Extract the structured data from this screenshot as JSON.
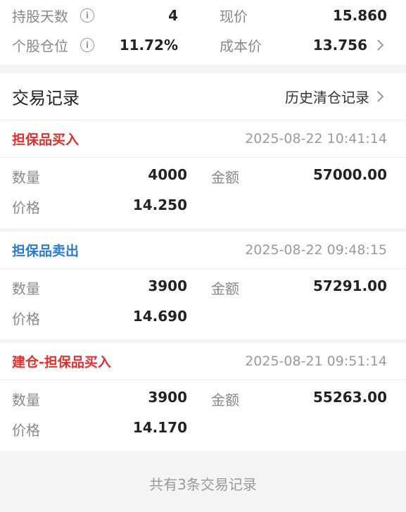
{
  "summary": {
    "hold_days_label": "持股天数",
    "hold_days_value": "4",
    "price_label": "现价",
    "price_value": "15.860",
    "position_label": "个股仓位",
    "position_value": "11.72%",
    "cost_label": "成本价",
    "cost_value": "13.756"
  },
  "section": {
    "title": "交易记录",
    "history_link": "历史清仓记录"
  },
  "records": [
    {
      "type": "担保品买入",
      "time": "2025-08-22 10:41:14",
      "qty_label": "数量",
      "qty": "4000",
      "amount_label": "金额",
      "amount": "57000.00",
      "price_label": "价格",
      "price": "14.250"
    },
    {
      "type": "担保品卖出",
      "time": "2025-08-22 09:48:15",
      "qty_label": "数量",
      "qty": "3900",
      "amount_label": "金额",
      "amount": "57291.00",
      "price_label": "价格",
      "price": "14.690"
    },
    {
      "type": "建仓-担保品买入",
      "time": "2025-08-21 09:51:14",
      "qty_label": "数量",
      "qty": "3900",
      "amount_label": "金额",
      "amount": "55263.00",
      "price_label": "价格",
      "price": "14.170"
    }
  ],
  "footer": {
    "count_text": "共有3条交易记录"
  },
  "colors": {
    "buy": "#e03131",
    "sell": "#2b7bd6"
  },
  "icons": {
    "info": "info-circle-icon",
    "chevron": "chevron-right-icon"
  }
}
